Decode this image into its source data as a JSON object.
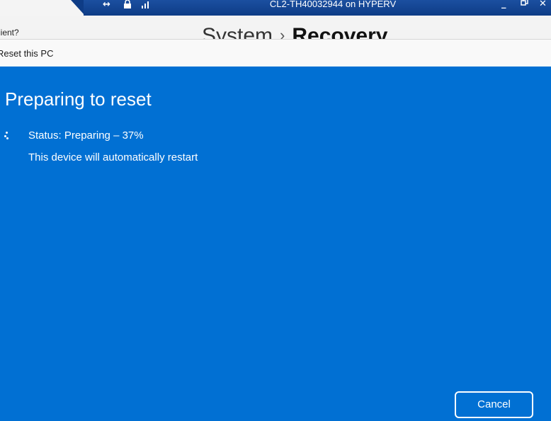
{
  "connection_bar": {
    "title": "CL2-TH40032944 on HYPERV",
    "icons": [
      "pin-icon",
      "lock-icon",
      "signal-icon"
    ],
    "controls": {
      "minimize": "_",
      "restore": "❐",
      "close": "✕"
    },
    "colors": {
      "bar": "#0e3c86"
    }
  },
  "settings": {
    "left_text": "lient?",
    "breadcrumb": {
      "parent": "System",
      "separator": "›",
      "current": "Recovery"
    }
  },
  "dialog": {
    "title": "Reset this PC",
    "heading": "Preparing to reset",
    "status": "Status: Preparing – 37%",
    "progress_percent": 37,
    "message": "This device will automatically restart",
    "cancel_label": "Cancel",
    "colors": {
      "background": "#0170d3",
      "text": "#ffffff"
    }
  }
}
